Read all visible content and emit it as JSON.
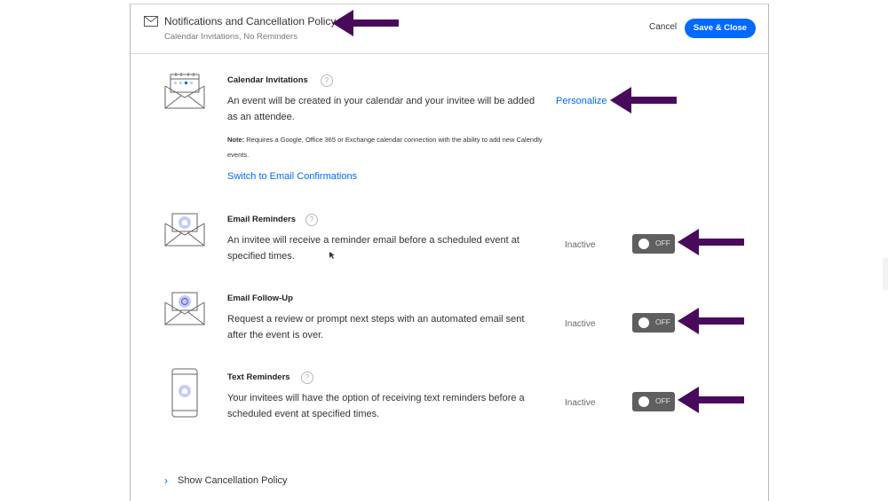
{
  "header": {
    "title": "Notifications and Cancellation Policy",
    "subtitle": "Calendar Invitations, No Reminders",
    "cancel_label": "Cancel",
    "save_label": "Save & Close"
  },
  "calendar": {
    "title": "Calendar Invitations",
    "help": "?",
    "description": "An event will be created in your calendar and your invitee will be added as an attendee.",
    "note_label": "Note:",
    "note_text": " Requires a Google, Office 365 or Exchange calendar connection with the ability to add new Calendly events.",
    "personalize_label": "Personalize",
    "switch_label": "Switch to Email Confirmations"
  },
  "email_reminders": {
    "title": "Email Reminders",
    "help": "?",
    "description": "An invitee will receive a reminder email before a scheduled event at specified times.",
    "status": "Inactive",
    "toggle_label": "OFF"
  },
  "email_followup": {
    "title": "Email Follow-Up",
    "help": "?",
    "description": "Request a review or prompt next steps with an automated email sent after the event is over.",
    "status": "Inactive",
    "toggle_label": "OFF"
  },
  "text_reminders": {
    "title": "Text Reminders",
    "help": "?",
    "description": "Your invitees will have the option of receiving text reminders before a scheduled event at specified times.",
    "status": "Inactive",
    "toggle_label": "OFF"
  },
  "footer": {
    "show_cancellation_label": "Show Cancellation Policy"
  },
  "icons": {
    "header": "envelope-icon",
    "calendar": "calendar-envelope-icon",
    "email_reminders": "bell-envelope-icon",
    "email_followup": "refresh-envelope-icon",
    "text_reminders": "phone-bell-icon",
    "expand": "chevron-right-icon",
    "annotation": "arrow-left-icon"
  },
  "colors": {
    "primary": "#0069ff",
    "toggle_off": "#5f5f5f",
    "annotation_arrow": "#4a0a5c",
    "icon_accent": "#a9b8ff"
  }
}
